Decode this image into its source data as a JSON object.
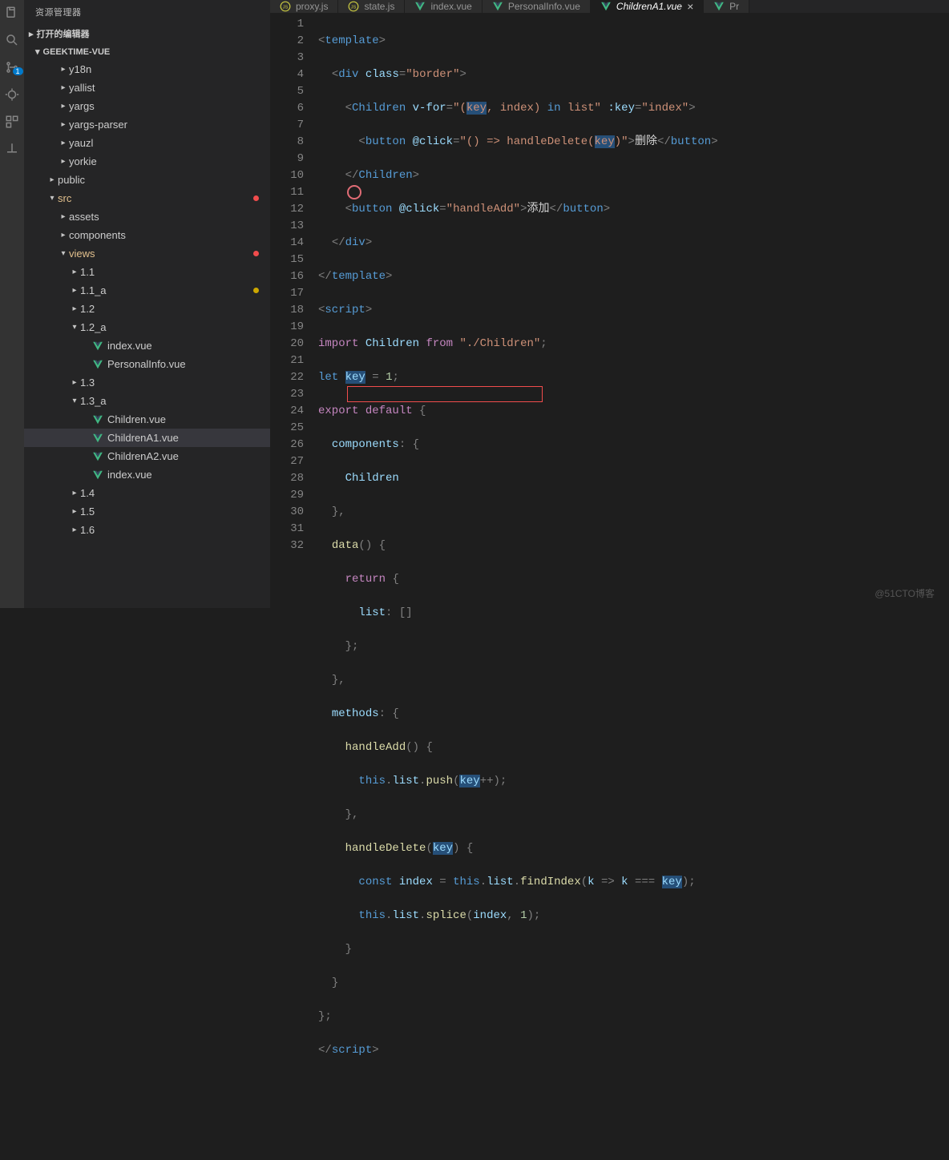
{
  "sidebar": {
    "title": "资源管理器",
    "open_editors": "打开的编辑器",
    "project": "GEEKTIME-VUE",
    "tree": [
      {
        "label": "y18n",
        "depth": 3,
        "kind": "folder"
      },
      {
        "label": "yallist",
        "depth": 3,
        "kind": "folder"
      },
      {
        "label": "yargs",
        "depth": 3,
        "kind": "folder"
      },
      {
        "label": "yargs-parser",
        "depth": 3,
        "kind": "folder"
      },
      {
        "label": "yauzl",
        "depth": 3,
        "kind": "folder"
      },
      {
        "label": "yorkie",
        "depth": 3,
        "kind": "folder"
      },
      {
        "label": "public",
        "depth": 2,
        "kind": "folder"
      },
      {
        "label": "src",
        "depth": 2,
        "kind": "folder",
        "open": true,
        "orange": true,
        "dot": "red"
      },
      {
        "label": "assets",
        "depth": 3,
        "kind": "folder"
      },
      {
        "label": "components",
        "depth": 3,
        "kind": "folder"
      },
      {
        "label": "views",
        "depth": 3,
        "kind": "folder",
        "open": true,
        "orange": true,
        "dot": "red"
      },
      {
        "label": "1.1",
        "depth": 4,
        "kind": "folder"
      },
      {
        "label": "1.1_a",
        "depth": 4,
        "kind": "folder",
        "dot": "yellow"
      },
      {
        "label": "1.2",
        "depth": 4,
        "kind": "folder"
      },
      {
        "label": "1.2_a",
        "depth": 4,
        "kind": "folder",
        "open": true
      },
      {
        "label": "index.vue",
        "depth": 5,
        "kind": "vue"
      },
      {
        "label": "PersonalInfo.vue",
        "depth": 5,
        "kind": "vue"
      },
      {
        "label": "1.3",
        "depth": 4,
        "kind": "folder"
      },
      {
        "label": "1.3_a",
        "depth": 4,
        "kind": "folder",
        "open": true
      },
      {
        "label": "Children.vue",
        "depth": 5,
        "kind": "vue"
      },
      {
        "label": "ChildrenA1.vue",
        "depth": 5,
        "kind": "vue",
        "selected": true
      },
      {
        "label": "ChildrenA2.vue",
        "depth": 5,
        "kind": "vue"
      },
      {
        "label": "index.vue",
        "depth": 5,
        "kind": "vue"
      },
      {
        "label": "1.4",
        "depth": 4,
        "kind": "folder"
      },
      {
        "label": "1.5",
        "depth": 4,
        "kind": "folder"
      },
      {
        "label": "1.6",
        "depth": 4,
        "kind": "folder"
      }
    ]
  },
  "tabs": [
    {
      "label": "proxy.js",
      "icon": "js"
    },
    {
      "label": "state.js",
      "icon": "js"
    },
    {
      "label": "index.vue",
      "icon": "vue"
    },
    {
      "label": "PersonalInfo.vue",
      "icon": "vue"
    },
    {
      "label": "ChildrenA1.vue",
      "icon": "vue",
      "active": true
    },
    {
      "label": "Pr",
      "icon": "vue"
    }
  ],
  "badge_count": "1",
  "code_lines": 32,
  "watermark": "@51CTO博客",
  "colors": {
    "bg": "#1e1e1e",
    "sidebar": "#252526",
    "activity": "#333333",
    "accent": "#007acc",
    "orange": "#e2c08d",
    "red": "#f14c4c",
    "yellow": "#cca700"
  },
  "code_text": {
    "l1": "template",
    "l2_attr": "class",
    "l2_val": "\"border\"",
    "l3_tag": "Children",
    "l3_vfor": "v-for",
    "l3_vfor_val": "\"(key, index) in list\"",
    "l3_key": ":key",
    "l3_key_val": "\"index\"",
    "l4_tag": "button",
    "l4_click": "@click",
    "l4_click_val": "\"() => handleDelete(key)\"",
    "l4_txt": "删除",
    "l6_click_val": "\"handleAdd\"",
    "l6_txt": "添加",
    "l10_from": "\"./Children\"",
    "l11_var": "key",
    "l11_val": "1",
    "l13_comp": "components",
    "l14_child": "Children",
    "l16_data": "data",
    "l18_list": "list",
    "l21_methods": "methods",
    "l22_add": "handleAdd",
    "l23_this": "this",
    "l23_list": "list",
    "l23_push": "push",
    "l23_key": "key",
    "l25_del": "handleDelete",
    "l25_key": "key",
    "l26_const": "const",
    "l26_idx": "index",
    "l26_fi": "findIndex",
    "l26_key": "key",
    "l27_splice": "splice",
    "l27_one": "1"
  }
}
